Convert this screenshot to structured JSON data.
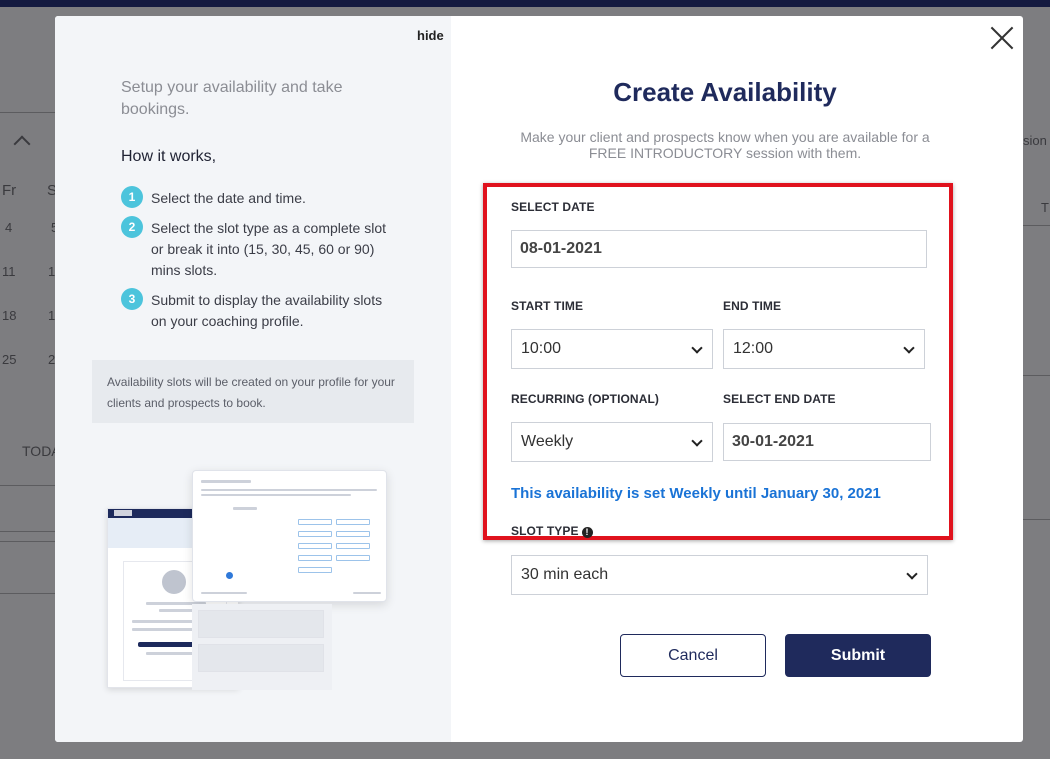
{
  "background": {
    "weekdays": [
      "Fr",
      "S"
    ],
    "dates": [
      "4",
      "5",
      "11",
      "1",
      "18",
      "1",
      "25",
      "2"
    ],
    "today_label": "TODA",
    "right_fragments": [
      "sion",
      "T"
    ]
  },
  "left": {
    "hide_label": "hide",
    "intro": "Setup your availability and take bookings.",
    "how_title": "How it works,",
    "steps": [
      {
        "num": "1",
        "text": "Select the date and time."
      },
      {
        "num": "2",
        "text": "Select the slot type as a complete slot or break it into (15, 30, 45, 60 or 90) mins slots."
      },
      {
        "num": "3",
        "text": "Submit to display the availability slots on your coaching profile."
      }
    ],
    "note": "Availability slots will be created on your profile for your clients and prospects to book."
  },
  "form": {
    "title": "Create Availability",
    "subtitle": "Make your client and prospects know when you are available for a FREE INTRODUCTORY session with them.",
    "select_date_label": "SELECT DATE",
    "select_date_value": "08-01-2021",
    "start_time_label": "START TIME",
    "start_time_value": "10:00",
    "end_time_label": "END TIME",
    "end_time_value": "12:00",
    "recurring_label": "RECURRING (OPTIONAL)",
    "recurring_value": "Weekly",
    "end_date_label": "SELECT END DATE",
    "end_date_value": "30-01-2021",
    "status_message": "This availability is set Weekly until January 30, 2021",
    "slot_type_label": "SLOT TYPE",
    "slot_type_value": "30 min each",
    "cancel_label": "Cancel",
    "submit_label": "Submit"
  },
  "colors": {
    "brand_navy": "#1f2a5c",
    "accent_teal": "#4cc4dc",
    "highlight_red": "#e0121d",
    "status_blue": "#1a73d6"
  },
  "icons": [
    "close-icon",
    "chevron-down-icon",
    "info-icon",
    "chevron-up-icon"
  ]
}
